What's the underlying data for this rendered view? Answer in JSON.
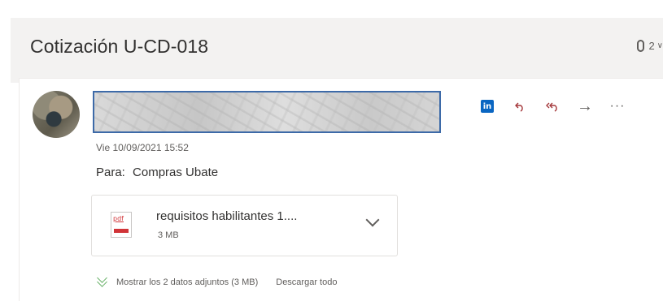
{
  "subject": {
    "title": "Cotización U-CD-018",
    "attachment_count": "2",
    "clip_icon": "paperclip-icon",
    "dropdown_icon": "chevron-down-icon"
  },
  "message": {
    "date": "Vie 10/09/2021 15:52",
    "to_label": "Para:",
    "to_value": "Compras Ubate",
    "actions": {
      "linkedin_label": "in",
      "reply_glyph": "⟲",
      "reply_all_glyph": "↶↶",
      "forward_glyph": "→",
      "more_glyph": "···"
    }
  },
  "attachment": {
    "icon_label": "pdf",
    "name": "requisitos habilitantes 1....",
    "size": "3 MB"
  },
  "footer": {
    "show_all": "Mostrar los 2 datos adjuntos (3 MB)",
    "download_all": "Descargar todo"
  },
  "colors": {
    "accent_blue": "#3d6aa8",
    "linkedin": "#0a66c2",
    "reply_red": "#a4373a",
    "pdf_red": "#d13438",
    "chevron_green": "#6bb26b"
  }
}
